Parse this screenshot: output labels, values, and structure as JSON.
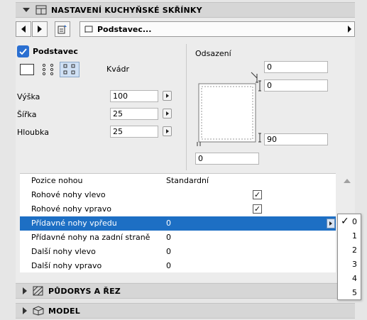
{
  "header": {
    "title": "NASTAVENÍ KUCHYŇSKÉ SKŘÍNKY"
  },
  "toolbar": {
    "dropdown_value": "Podstavec..."
  },
  "base": {
    "checkbox_label": "Podstavec",
    "shape_label": "Kvádr",
    "fields": [
      {
        "label": "Výška",
        "value": "100"
      },
      {
        "label": "Šířka",
        "value": "25"
      },
      {
        "label": "Hloubka",
        "value": "25"
      }
    ]
  },
  "offset": {
    "label": "Odsazení",
    "top": "0",
    "top2": "0",
    "right": "90",
    "bottom": "0"
  },
  "table": {
    "rows": [
      {
        "label": "Pozice nohou",
        "value": "Standardní"
      },
      {
        "label": "Rohové nohy vlevo",
        "value": ""
      },
      {
        "label": "Rohové nohy vpravo",
        "value": ""
      },
      {
        "label": "Přídavné nohy vpředu",
        "value": "0"
      },
      {
        "label": "Přídavné nohy na zadní straně",
        "value": "0"
      },
      {
        "label": "Další nohy vlevo",
        "value": "0"
      },
      {
        "label": "Další nohy vpravo",
        "value": "0"
      }
    ]
  },
  "popup": {
    "options": [
      "0",
      "1",
      "2",
      "3",
      "4",
      "5"
    ],
    "selected": "0"
  },
  "sections": {
    "floorplan": "PŮDORYS A ŘEZ",
    "model": "MODEL"
  },
  "colors": {
    "selection": "#1d6fc4",
    "checkbox_accent": "#2a6fd1"
  }
}
